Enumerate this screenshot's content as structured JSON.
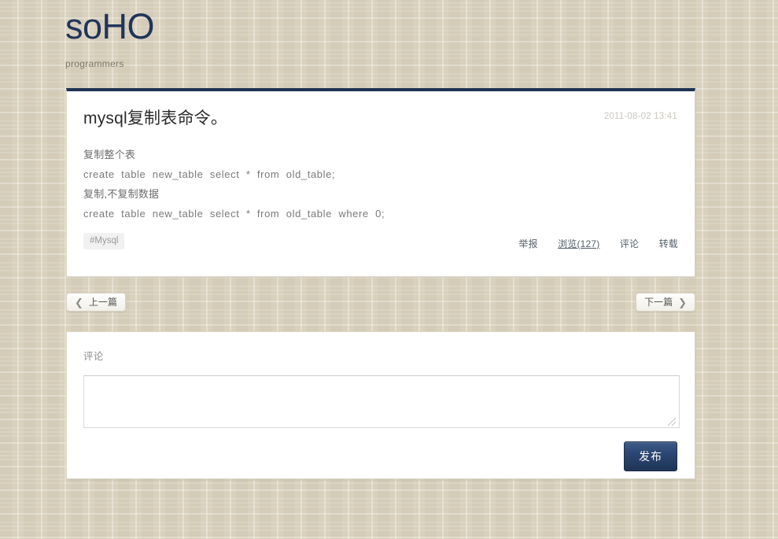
{
  "header": {
    "logo": "soHO",
    "tagline": "programmers"
  },
  "post": {
    "title": "mysql复制表命令。",
    "timestamp": "2011-08-02 13:41",
    "body_lines": [
      {
        "text": "复制整个表",
        "code": false
      },
      {
        "text": "create  table  new_table  select  *  from  old_table;",
        "code": true
      },
      {
        "text": "复制,不复制数据",
        "code": false
      },
      {
        "text": "create  table  new_table  select  *  from  old_table  where  0;",
        "code": true
      }
    ],
    "tag": "#Mysql",
    "actions": [
      {
        "label": "举报",
        "underlined": false
      },
      {
        "label": "浏览(127)",
        "underlined": true
      },
      {
        "label": "评论",
        "underlined": false
      },
      {
        "label": "转载",
        "underlined": false
      }
    ]
  },
  "pager": {
    "prev_label": "上一篇",
    "prev_icon": "chevron-left-icon",
    "next_label": "下一篇",
    "next_icon": "chevron-right-icon"
  },
  "comment": {
    "label": "评论",
    "textarea_value": "",
    "textarea_placeholder": "",
    "publish_label": "发布"
  },
  "colors": {
    "accent": "#1d3253",
    "logo": "#21355a",
    "page_background": "#d9d1bc",
    "card_background": "#ffffff",
    "publish_button": "#2c4672",
    "tag_background": "#f1f1f1"
  }
}
